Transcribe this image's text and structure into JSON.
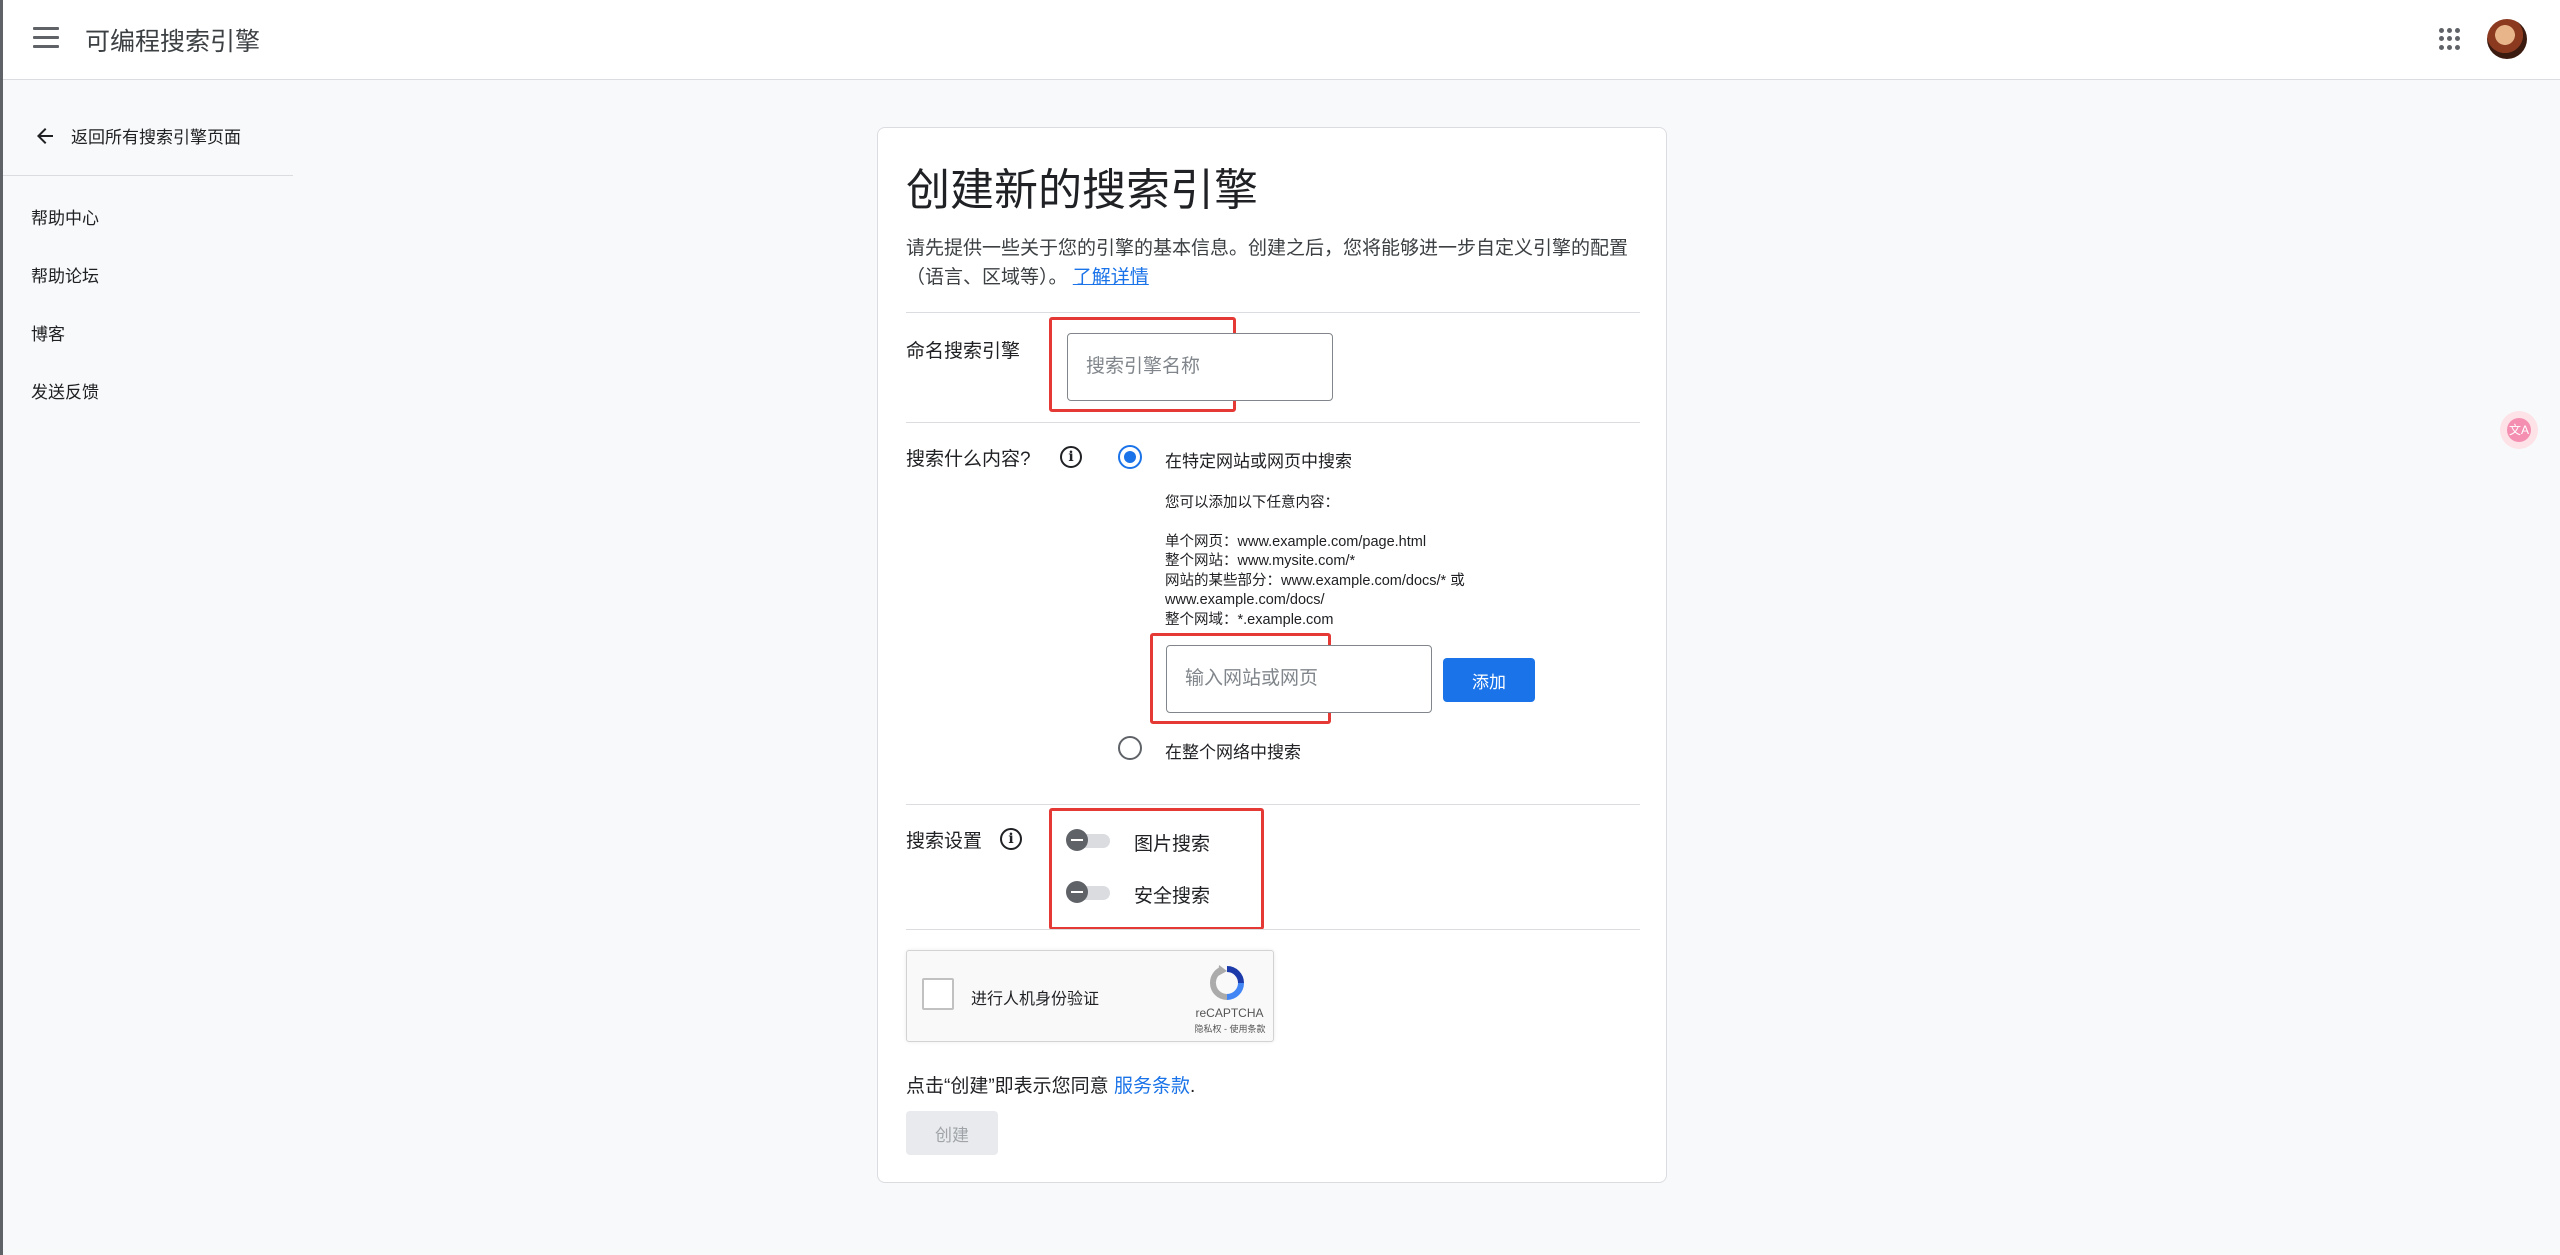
{
  "header": {
    "app_title": "可编程搜索引擎"
  },
  "sidebar": {
    "back_label": "返回所有搜索引擎页面",
    "items": [
      "帮助中心",
      "帮助论坛",
      "博客",
      "发送反馈"
    ]
  },
  "form": {
    "title": "创建新的搜索引擎",
    "intro": "请先提供一些关于您的引擎的基本信息。创建之后，您将能够进一步自定义引擎的配置（语言、区域等）。",
    "learn_more": "了解详情",
    "name_label": "命名搜索引擎",
    "name_placeholder": "搜索引擎名称",
    "what_label": "搜索什么内容?",
    "option_specific": "在特定网站或网页中搜索",
    "hint_title": "您可以添加以下任意内容：",
    "hint_lines": [
      "单个网页：www.example.com/page.html",
      "整个网站：www.mysite.com/*",
      "网站的某些部分：www.example.com/docs/* 或",
      "www.example.com/docs/",
      "整个网域：*.example.com"
    ],
    "site_placeholder": "输入网站或网页",
    "add_button": "添加",
    "option_web": "在整个网络中搜索",
    "settings_label": "搜索设置",
    "toggle_image": "图片搜索",
    "toggle_safe": "安全搜索",
    "captcha_label": "进行人机身份验证",
    "captcha_brand": "reCAPTCHA",
    "captcha_links": "隐私权 - 使用条款",
    "terms_prefix": "点击“创建”即表示您同意 ",
    "terms_link": "服务条款",
    "terms_suffix": ".",
    "create_button": "创建"
  },
  "colors": {
    "accent": "#1a73e8",
    "highlight_box": "#e53935"
  }
}
